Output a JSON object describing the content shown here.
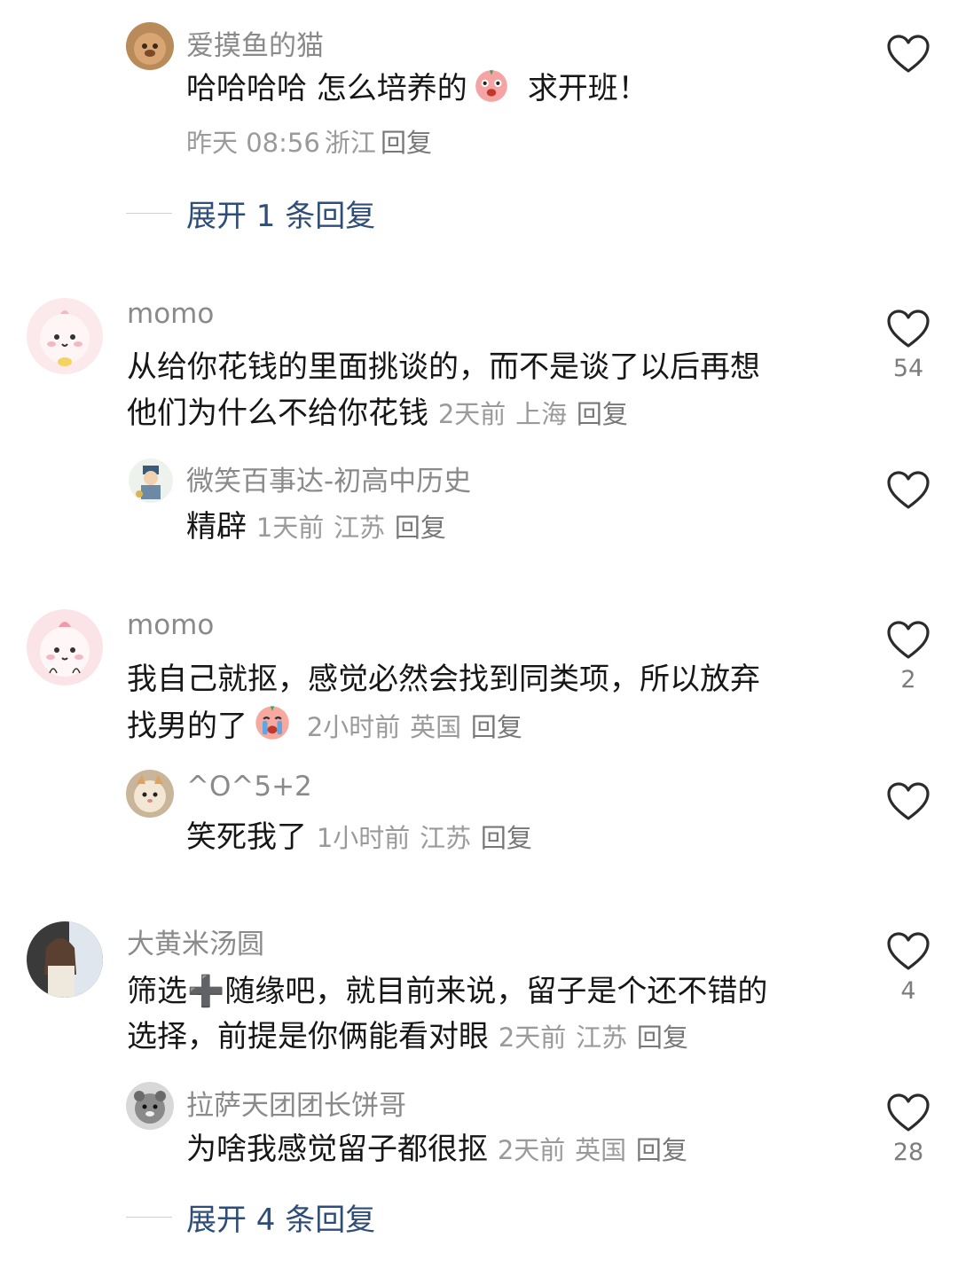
{
  "comments": [
    {
      "username": "爱摸鱼的猫",
      "text_before_emoji": "哈哈哈哈 怎么培养的",
      "emoji": "pig-face-emoji",
      "text_after_emoji": "求开班！",
      "time": "昨天 08:56",
      "location": "浙江",
      "reply": "回复",
      "likes": "",
      "expand": "展开 1 条回复"
    },
    {
      "username": "momo",
      "text_line1": "从给你花钱的里面挑谈的，而不是谈了以后再想",
      "text_line2": "他们为什么不给你花钱",
      "time": "2天前",
      "location": "上海",
      "reply": "回复",
      "likes": "54",
      "reply_item": {
        "username": "微笑百事达-初高中历史",
        "text": "精辟",
        "time": "1天前",
        "location": "江苏",
        "reply": "回复",
        "likes": ""
      }
    },
    {
      "username": "momo",
      "text_line1": "我自己就抠，感觉必然会找到同类项，所以放弃",
      "text_line2": "找男的了",
      "emoji": "crying-face-emoji",
      "time": "2小时前",
      "location": "英国",
      "reply": "回复",
      "likes": "2",
      "reply_item": {
        "username": "^O^5+2",
        "text": "笑死我了",
        "time": "1小时前",
        "location": "江苏",
        "reply": "回复",
        "likes": ""
      }
    },
    {
      "username": "大黄米汤圆",
      "text_line1_a": "筛选",
      "text_line1_symbol": "➕",
      "text_line1_b": "随缘吧，就目前来说，留子是个还不错的",
      "text_line2": "选择，前提是你俩能看对眼",
      "time": "2天前",
      "location": "江苏",
      "reply": "回复",
      "likes": "4",
      "reply_item": {
        "username": "拉萨天团团长饼哥",
        "text": "为啥我感觉留子都很抠",
        "time": "2天前",
        "location": "英国",
        "reply": "回复",
        "likes": "28"
      },
      "expand": "展开 4 条回复"
    }
  ],
  "colors": {
    "username": "#8a8a8a",
    "text": "#161616",
    "meta": "#9a9a9a",
    "expand": "#2f4d79",
    "heart": "#2b2b2b"
  }
}
